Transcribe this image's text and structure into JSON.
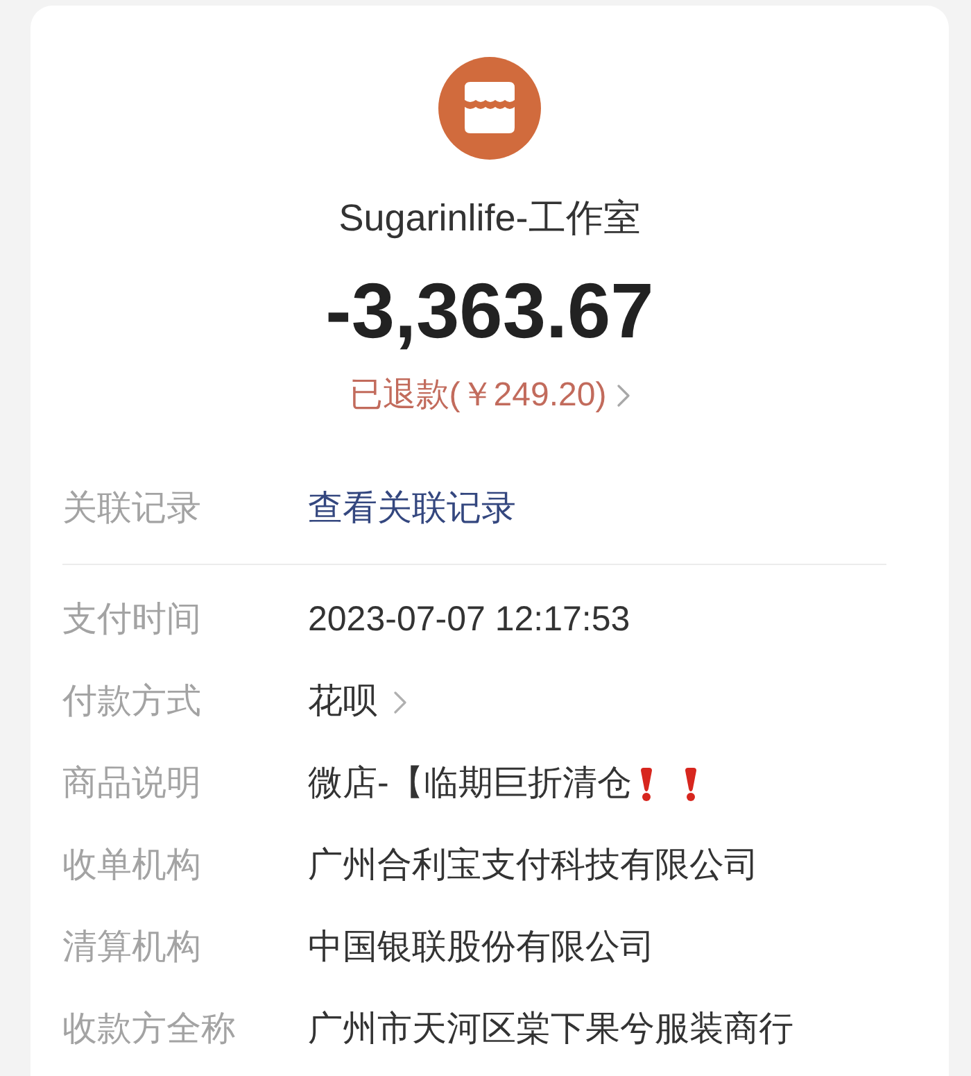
{
  "merchant": {
    "name": "Sugarinlife-工作室",
    "amount": "-3,363.67",
    "refund": {
      "text": "已退款(￥249.20)",
      "chevron": true
    }
  },
  "sections": [
    {
      "rows": [
        {
          "label": "关联记录",
          "value": "查看关联记录",
          "kind": "link"
        }
      ]
    },
    {
      "rows": [
        {
          "label": "支付时间",
          "value": "2023-07-07 12:17:53",
          "kind": "text"
        },
        {
          "label": "付款方式",
          "value": "花呗",
          "kind": "menu"
        },
        {
          "label": "商品说明",
          "value": "微店-【临期巨折清仓",
          "kind": "text",
          "icons": [
            {
              "kind": "exclamation"
            },
            {
              "kind": "exclamation"
            }
          ]
        },
        {
          "label": "收单机构",
          "value": "广州合利宝支付科技有限公司",
          "kind": "text"
        },
        {
          "label": "清算机构",
          "value": "中国银联股份有限公司",
          "kind": "text"
        },
        {
          "label": "收款方全称",
          "value": "广州市天河区棠下果兮服装商行",
          "kind": "text"
        }
      ]
    }
  ]
}
